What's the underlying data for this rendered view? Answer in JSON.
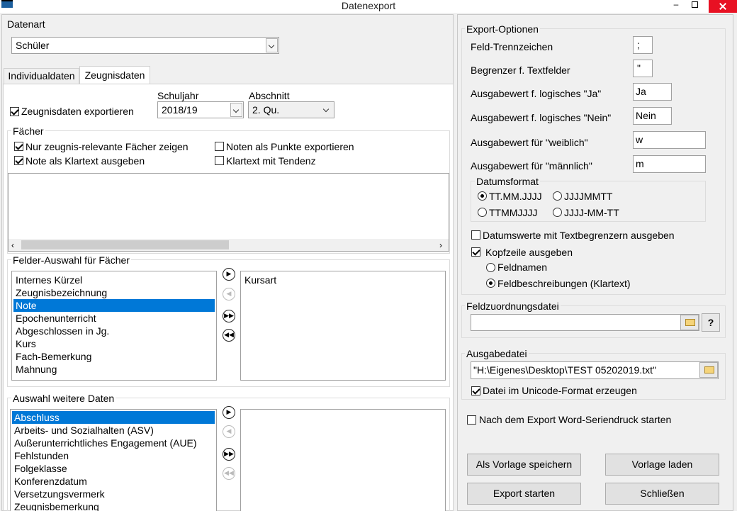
{
  "window": {
    "title": "Datenexport"
  },
  "datenart": {
    "label": "Datenart",
    "value": "Schüler"
  },
  "tabs": [
    "Individualdaten",
    "Zeugnisdaten"
  ],
  "zeugnis": {
    "export_label": "Zeugnisdaten exportieren",
    "export_checked": true,
    "schuljahr_label": "Schuljahr",
    "schuljahr_value": "2018/19",
    "abschnitt_label": "Abschnitt",
    "abschnitt_value": "2. Qu."
  },
  "faecher": {
    "label": "Fächer",
    "options": [
      {
        "label": "Nur zeugnis-relevante Fächer zeigen",
        "checked": true
      },
      {
        "label": "Noten als Punkte exportieren",
        "checked": false
      },
      {
        "label": "Note als Klartext ausgeben",
        "checked": true
      },
      {
        "label": "Klartext mit Tendenz",
        "checked": false
      }
    ]
  },
  "felder_auswahl": {
    "label": "Felder-Auswahl für Fächer",
    "available": [
      "Internes Kürzel",
      "Zeugnisbezeichnung",
      "Note",
      "Epochenunterricht",
      "Abgeschlossen in Jg.",
      "Kurs",
      "Fach-Bemerkung",
      "Mahnung"
    ],
    "selected_index": 2,
    "chosen": [
      "Kursart"
    ]
  },
  "weitere_daten": {
    "label": "Auswahl weitere Daten",
    "available": [
      "Abschluss",
      "Arbeits- und Sozialhalten (ASV)",
      "Außerunterrichtliches Engagement (AUE)",
      "Fehlstunden",
      "Folgeklasse",
      "Konferenzdatum",
      "Versetzungsvermerk",
      "Zeugnisbemerkung"
    ],
    "selected_index": 0,
    "chosen": []
  },
  "export_optionen": {
    "label": "Export-Optionen",
    "fields": [
      {
        "label": "Feld-Trennzeichen",
        "value": ";"
      },
      {
        "label": "Begrenzer f. Textfelder",
        "value": "\""
      },
      {
        "label": "Ausgabewert f. logisches \"Ja\"",
        "value": "Ja"
      },
      {
        "label": "Ausgabewert f. logisches \"Nein\"",
        "value": "Nein"
      },
      {
        "label": "Ausgabewert für \"weiblich\"",
        "value": "w"
      },
      {
        "label": "Ausgabewert für \"männlich\"",
        "value": "m"
      }
    ],
    "datumsformat_label": "Datumsformat",
    "datumsformat": [
      {
        "label": "TT.MM.JJJJ",
        "selected": true
      },
      {
        "label": "JJJJMMTT",
        "selected": false
      },
      {
        "label": "TTMMJJJJ",
        "selected": false
      },
      {
        "label": "JJJJ-MM-TT",
        "selected": false
      }
    ],
    "datumswerte_label": "Datumswerte mit Textbegrenzern ausgeben",
    "datumswerte_checked": false,
    "kopfzeile_label": "Kopfzeile ausgeben",
    "kopfzeile_checked": true,
    "kopfzeile_options": [
      {
        "label": "Feldnamen",
        "selected": false
      },
      {
        "label": "Feldbeschreibungen (Klartext)",
        "selected": true
      }
    ]
  },
  "feldzuordnung": {
    "label": "Feldzuordnungsdatei",
    "value": "",
    "help": "?"
  },
  "ausgabedatei": {
    "label": "Ausgabedatei",
    "value": "\"H:\\Eigenes\\Desktop\\TEST 05202019.txt\"",
    "unicode_label": "Datei im Unicode-Format erzeugen",
    "unicode_checked": true
  },
  "seriendruck": {
    "label": "Nach dem Export Word-Seriendruck starten",
    "checked": false
  },
  "buttons": {
    "save_template": "Als Vorlage speichern",
    "load_template": "Vorlage laden",
    "start_export": "Export starten",
    "close": "Schließen"
  }
}
